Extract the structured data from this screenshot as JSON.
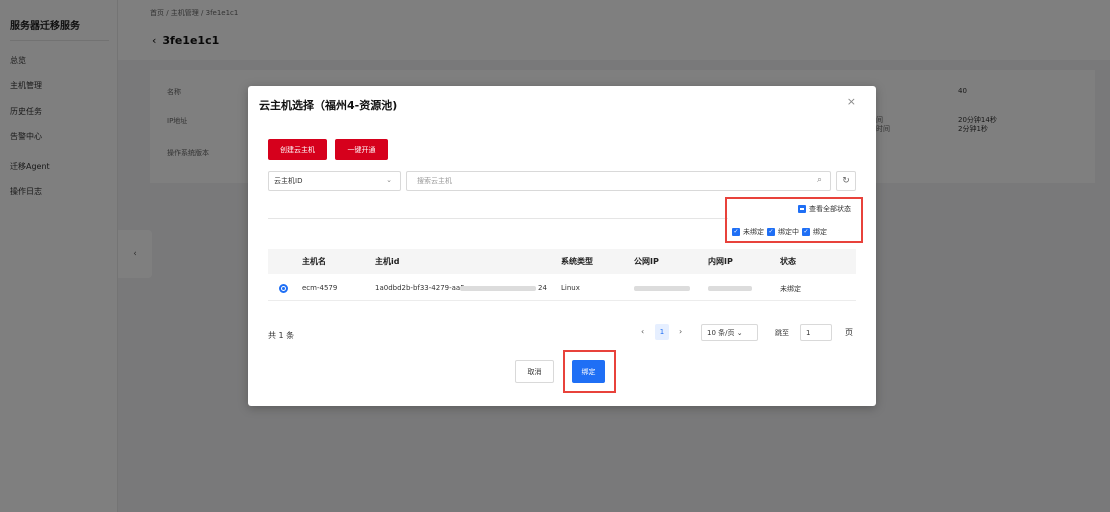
{
  "sidebar": {
    "brand": "服务器迁移服务",
    "items": [
      {
        "label": "总览"
      },
      {
        "label": "主机管理"
      },
      {
        "label": "历史任务"
      },
      {
        "label": "告警中心"
      },
      {
        "label": "迁移Agent"
      },
      {
        "label": "操作日志"
      }
    ],
    "collapse_glyph": "‹"
  },
  "header": {
    "breadcrumb": "首页 / 主机管理 / 3fe1e1c1",
    "back_glyph": "‹",
    "title": "3fe1e1c1"
  },
  "info": {
    "label_name": "名称",
    "label_ip": "IP地址",
    "label_os": "操作系统版本",
    "right_value_1": "40",
    "right_value_2": "20分钟14秒",
    "right_value_3": "2分钟1秒",
    "partial_label_1": "间",
    "partial_label_2": "时间"
  },
  "modal": {
    "title": "云主机选择（福州4-资源池)",
    "close_glyph": "×",
    "create_btn": "创建云主机",
    "activate_btn": "一键开通",
    "select_value": "云主机ID",
    "select_arrow": "⌄",
    "search_placeholder": "搜索云主机",
    "search_glyph": "⌕",
    "refresh_glyph": "↻",
    "status_filter": {
      "check_all": "查看全部状态",
      "options": [
        "未绑定",
        "绑定中",
        "绑定"
      ]
    },
    "table": {
      "headers": [
        "主机名",
        "主机id",
        "系统类型",
        "公网IP",
        "内网IP",
        "状态"
      ],
      "rows": [
        {
          "name": "ecm-4579",
          "id_prefix": "1a0dbd2b-bf33-4279-aa5",
          "id_suffix": "24",
          "os": "Linux",
          "status": "未绑定"
        }
      ]
    },
    "pagination": {
      "total": "共 1 条",
      "prev": "‹",
      "page": "1",
      "next": "›",
      "page_size": "10 条/页 ⌄",
      "jump_label": "跳至",
      "jump_value": "1",
      "page_unit": "页"
    },
    "cancel_btn": "取消",
    "bind_btn": "绑定"
  }
}
